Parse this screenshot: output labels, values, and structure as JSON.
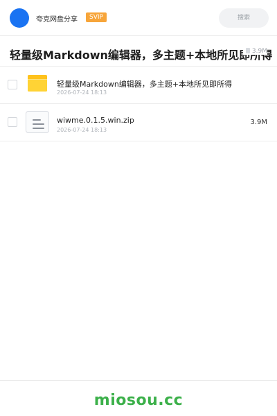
{
  "header": {
    "app_name": "夸克网盘分享",
    "badge": "SVIP",
    "search_placeholder": "搜索"
  },
  "share": {
    "title": "轻量级Markdown编辑器，多主题+本地所见即所得",
    "total_size": "3.9M"
  },
  "files": [
    {
      "name": "轻量级Markdown编辑器，多主题+本地所见即所得",
      "date": "2026-07-24 18:13",
      "size": "",
      "icon": "folder-icon"
    },
    {
      "name": "wiwme.0.1.5.win.zip",
      "date": "2026-07-24 18:13",
      "size": "3.9M",
      "icon": "zip-file-icon"
    }
  ],
  "footer": {
    "brand": "miosou.cc"
  },
  "colors": {
    "accent": "#1a73f2",
    "badge": "#f7a53a",
    "folder": "#ffc21c",
    "brand": "#3cb04a"
  }
}
